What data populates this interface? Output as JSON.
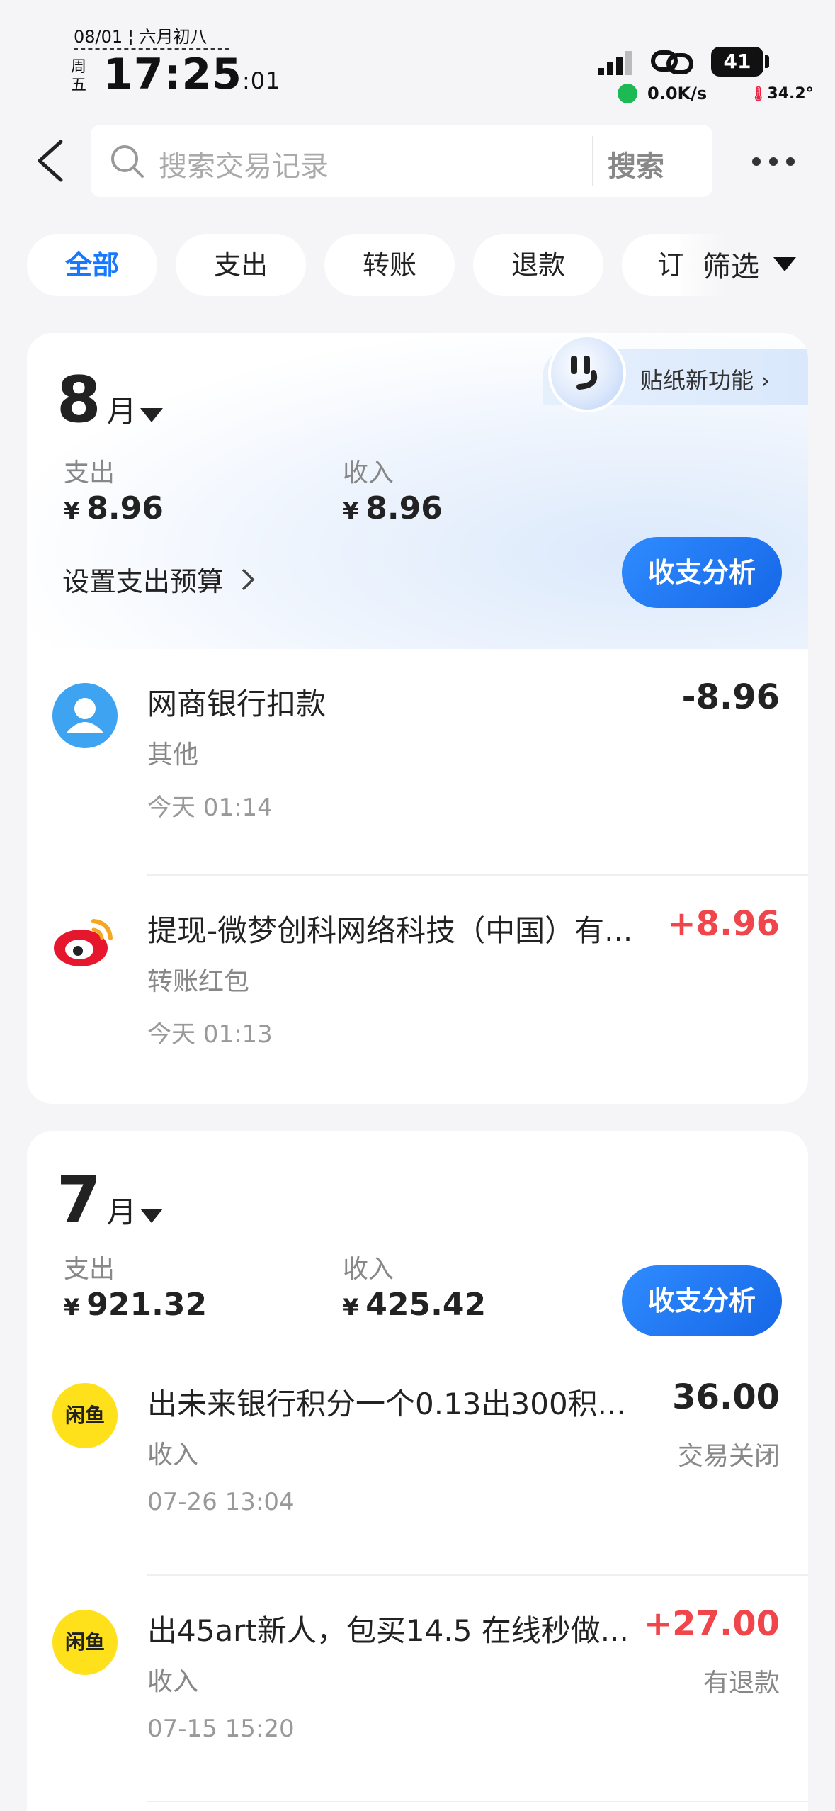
{
  "status_bar": {
    "date": "08/01 ¦ 六月初八",
    "weekday": "周五",
    "time": "17:25",
    "seconds": ":01",
    "battery": "41",
    "net_speed": "0.0K/s",
    "temperature": "34.2°"
  },
  "header": {
    "search_placeholder": "搜索交易记录",
    "search_button": "搜索"
  },
  "filters": {
    "chips": [
      "全部",
      "支出",
      "转账",
      "退款",
      "订"
    ],
    "active_index": 0,
    "filter_label": "筛选"
  },
  "months": [
    {
      "month": "8",
      "unit": "月",
      "sticker_label": "贴纸新功能 ›",
      "expense_label": "支出",
      "expense_currency": "¥",
      "expense_value": "8.96",
      "income_label": "收入",
      "income_currency": "¥",
      "income_value": "8.96",
      "budget_label": "设置支出预算",
      "analysis_button": "收支分析",
      "transactions": [
        {
          "title": "网商银行扣款",
          "category": "其他",
          "time": "今天 01:14",
          "amount": "-8.96",
          "status": "",
          "icon": "person-avatar-icon"
        },
        {
          "title": "提现-微梦创科网络科技（中国）有...",
          "category": "转账红包",
          "time": "今天 01:13",
          "amount": "+8.96",
          "status": "",
          "icon": "weibo-logo-icon"
        }
      ]
    },
    {
      "month": "7",
      "unit": "月",
      "expense_label": "支出",
      "expense_currency": "¥",
      "expense_value": "921.32",
      "income_label": "收入",
      "income_currency": "¥",
      "income_value": "425.42",
      "analysis_button": "收支分析",
      "transactions": [
        {
          "title": "出未来银行积分一个0.13出300积...",
          "category": "收入",
          "time": "07-26 13:04",
          "amount": "36.00",
          "status": "交易关闭",
          "icon": "xianyu-logo-icon",
          "logo_text": "闲鱼"
        },
        {
          "title": "出45art新人，包买14.5 在线秒做...",
          "category": "收入",
          "time": "07-15 15:20",
          "amount": "+27.00",
          "status": "有退款",
          "icon": "xianyu-logo-icon",
          "logo_text": "闲鱼"
        }
      ]
    }
  ],
  "colors": {
    "accent": "#1677ff",
    "positive": "#f0454b",
    "background": "#f5f5f7"
  }
}
